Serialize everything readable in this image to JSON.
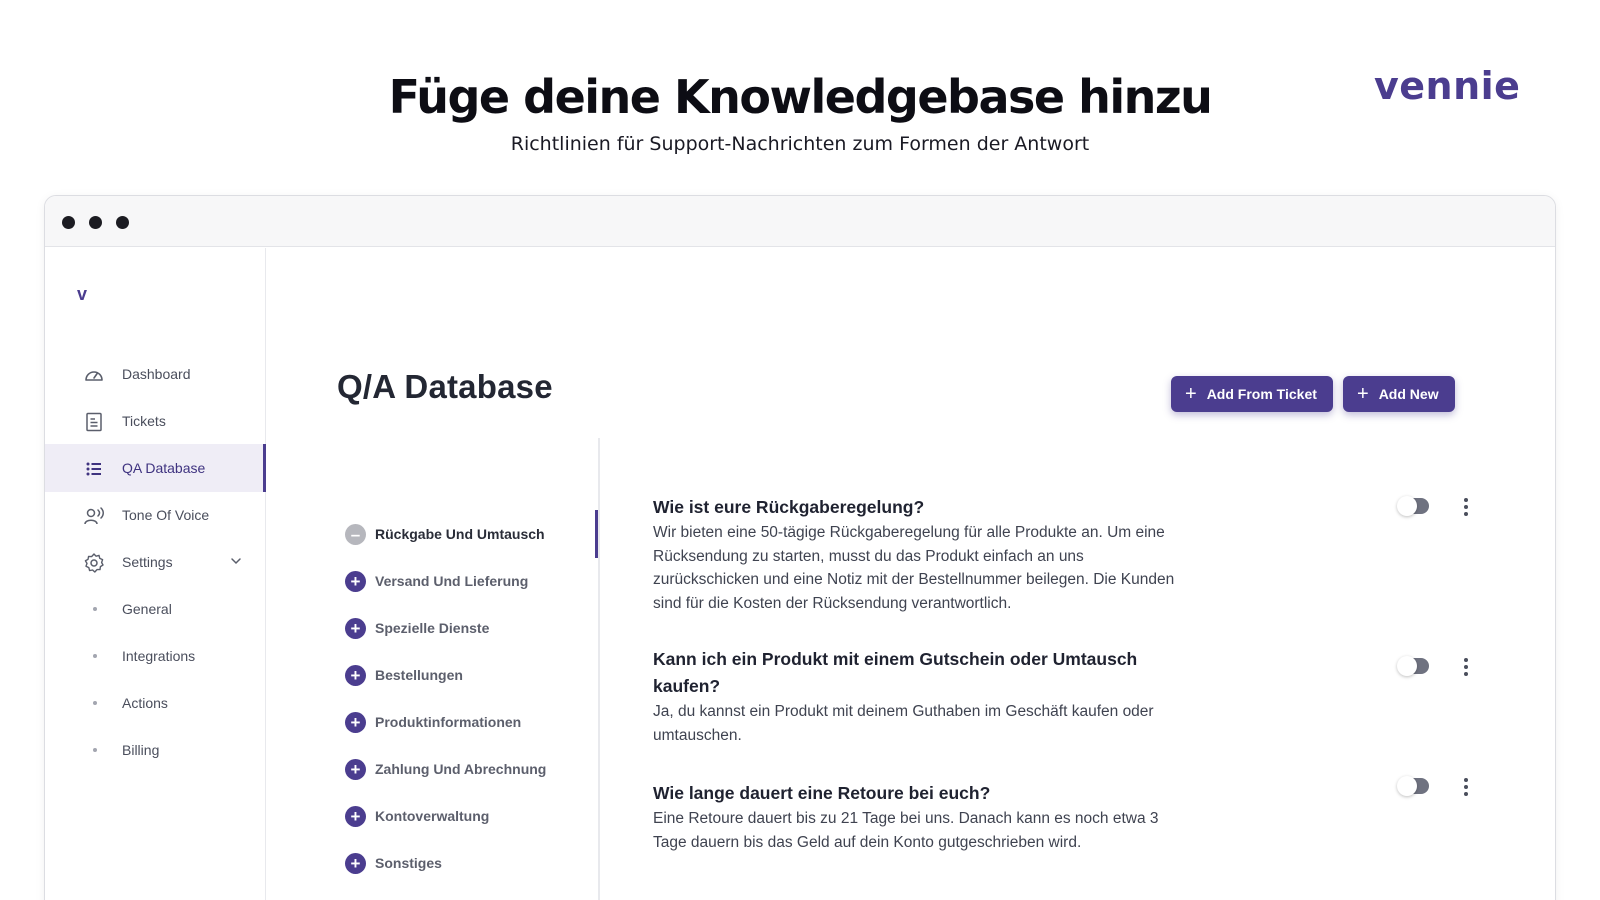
{
  "hero": {
    "title": "Füge deine Knowledgebase hinzu",
    "subtitle": "Richtlinien für Support-Nachrichten zum Formen der Antwort",
    "brand": "vennie"
  },
  "app": {
    "logo": "v",
    "sidebar": {
      "items": [
        {
          "label": "Dashboard",
          "icon": "gauge-icon"
        },
        {
          "label": "Tickets",
          "icon": "document-icon"
        },
        {
          "label": "QA Database",
          "icon": "list-icon"
        },
        {
          "label": "Tone Of Voice",
          "icon": "voice-user-icon"
        },
        {
          "label": "Settings",
          "icon": "gear-icon"
        }
      ],
      "sub_items": [
        "General",
        "Integrations",
        "Actions",
        "Billing"
      ]
    },
    "main": {
      "title": "Q/A Database",
      "add_from_ticket": "Add From Ticket",
      "add_new": "Add New",
      "categories": [
        "Rückgabe Und Umtausch",
        "Versand Und Lieferung",
        "Spezielle Dienste",
        "Bestellungen",
        "Produktinformationen",
        "Zahlung Und Abrechnung",
        "Kontoverwaltung",
        "Sonstiges"
      ],
      "qa": [
        {
          "question": "Wie ist eure Rückgaberegelung?",
          "answer": "Wir bieten eine 50-tägige Rückgaberegelung für alle Produkte an. Um eine Rücksendung zu starten, musst du das Produkt einfach an uns zurückschicken und eine Notiz mit der Bestellnummer beilegen. Die Kunden sind für die Kosten der Rücksendung verantwortlich."
        },
        {
          "question": "Kann ich ein Produkt mit einem Gutschein oder Umtausch kaufen?",
          "answer": "Ja, du kannst ein Produkt mit deinem Guthaben im Geschäft kaufen oder umtauschen."
        },
        {
          "question": "Wie lange dauert eine Retoure bei euch?",
          "answer": "Eine Retoure dauert bis zu 21 Tage bei uns. Danach kann es noch etwa 3 Tage dauern bis das Geld auf dein Konto gutgeschrieben wird."
        }
      ]
    }
  },
  "colors": {
    "accent": "#4b3d8f",
    "text": "#1f2230",
    "muted": "#4a4e5c"
  }
}
